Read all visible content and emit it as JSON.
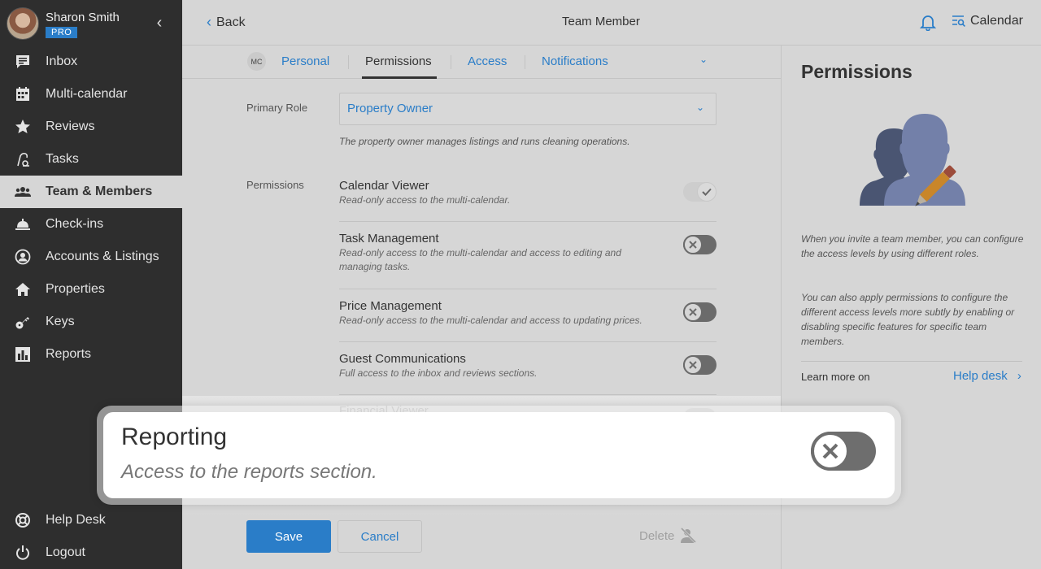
{
  "user": {
    "name": "Sharon Smith",
    "badge": "PRO"
  },
  "sidebar": {
    "items": [
      {
        "label": "Inbox",
        "icon": "inbox-icon"
      },
      {
        "label": "Multi-calendar",
        "icon": "calendar-icon"
      },
      {
        "label": "Reviews",
        "icon": "star-icon"
      },
      {
        "label": "Tasks",
        "icon": "vacuum-icon"
      },
      {
        "label": "Team & Members",
        "icon": "team-icon",
        "active": true
      },
      {
        "label": "Check-ins",
        "icon": "bell-desk-icon"
      },
      {
        "label": "Accounts & Listings",
        "icon": "account-icon"
      },
      {
        "label": "Properties",
        "icon": "home-icon"
      },
      {
        "label": "Keys",
        "icon": "key-icon"
      },
      {
        "label": "Reports",
        "icon": "reports-icon"
      }
    ],
    "bottom": [
      {
        "label": "Help Desk",
        "icon": "lifebuoy-icon"
      },
      {
        "label": "Logout",
        "icon": "power-icon"
      }
    ]
  },
  "topbar": {
    "back_label": "Back",
    "title": "Team Member",
    "calendar_label": "Calendar"
  },
  "tabs": {
    "avatar_initials": "MC",
    "items": [
      {
        "label": "Personal"
      },
      {
        "label": "Permissions",
        "active": true
      },
      {
        "label": "Access"
      },
      {
        "label": "Notifications"
      }
    ]
  },
  "form": {
    "primary_role_label": "Primary Role",
    "primary_role_value": "Property Owner",
    "role_description": "The property owner manages listings and runs cleaning operations.",
    "permissions_label": "Permissions",
    "permissions": [
      {
        "title": "Calendar Viewer",
        "desc": "Read-only access to the multi-calendar.",
        "enabled": true
      },
      {
        "title": "Task Management",
        "desc": "Read-only access to the multi-calendar and access to editing and managing tasks.",
        "enabled": false
      },
      {
        "title": "Price Management",
        "desc": "Read-only access to the multi-calendar and access to updating prices.",
        "enabled": false
      },
      {
        "title": "Guest Communications",
        "desc": "Full access to the inbox and reviews sections.",
        "enabled": false
      },
      {
        "title": "Financial Viewer",
        "desc": "",
        "enabled": false
      }
    ],
    "save_label": "Save",
    "cancel_label": "Cancel",
    "delete_label": "Delete"
  },
  "callout": {
    "title": "Reporting",
    "desc": "Access to the reports section.",
    "enabled": false
  },
  "help_panel": {
    "title": "Permissions",
    "para1": "When you invite a team member, you can configure the access levels by using different roles.",
    "para2": "You can also apply permissions to configure the different access levels more subtly by enabling or disabling specific features for specific team members.",
    "learn_more": "Learn more on",
    "help_link": "Help desk"
  },
  "colors": {
    "accent": "#2a7dc8",
    "sidebar_bg": "#2e2e2e",
    "page_bg": "#d6d6d6"
  }
}
